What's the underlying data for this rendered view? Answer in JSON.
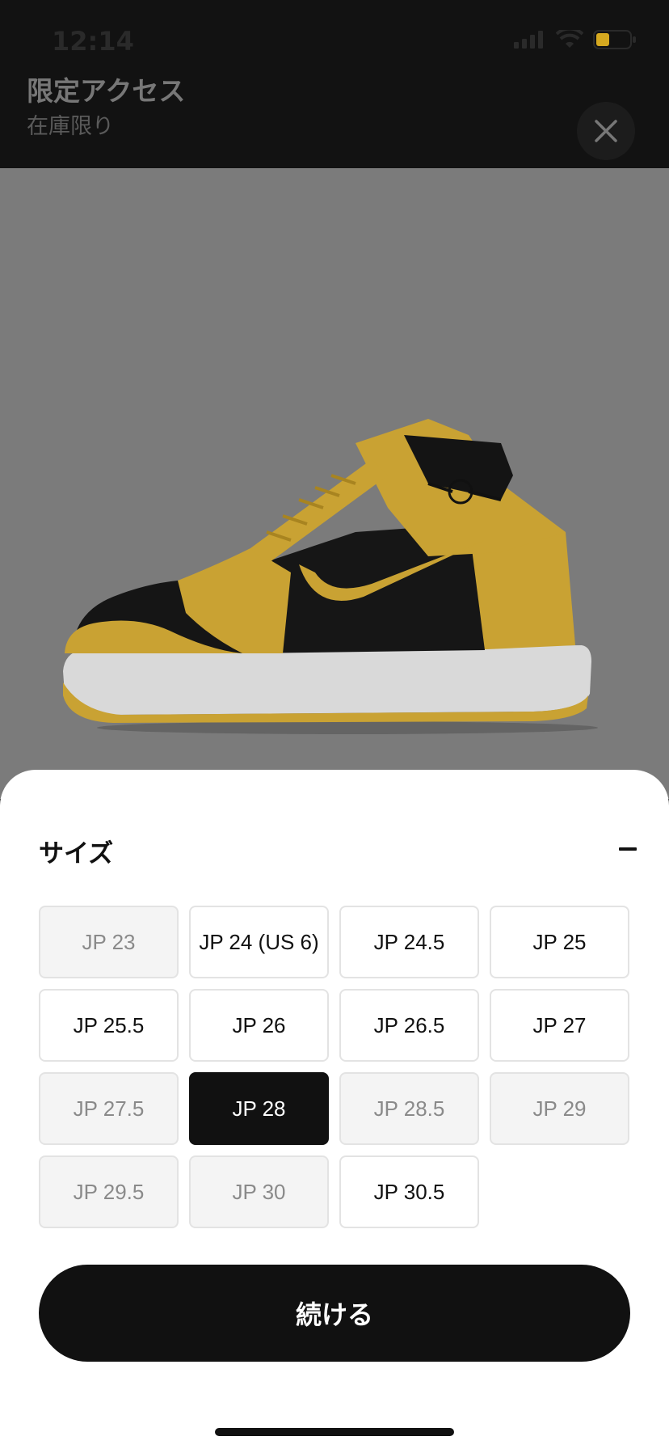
{
  "status_bar": {
    "time": "12:14"
  },
  "header": {
    "title": "限定アクセス",
    "subtitle": "在庫限り"
  },
  "product": {
    "image_icon": "sneaker-image",
    "colors": {
      "upper_yellow": "#c9a233",
      "upper_black": "#111111",
      "sole": "#e2e2e2"
    }
  },
  "sheet": {
    "title": "サイズ",
    "sizes": [
      {
        "label": "JP 23",
        "state": "disabled"
      },
      {
        "label": "JP 24 (US 6)",
        "state": "available"
      },
      {
        "label": "JP 24.5",
        "state": "available"
      },
      {
        "label": "JP 25",
        "state": "available"
      },
      {
        "label": "JP 25.5",
        "state": "available"
      },
      {
        "label": "JP 26",
        "state": "available"
      },
      {
        "label": "JP 26.5",
        "state": "available"
      },
      {
        "label": "JP 27",
        "state": "available"
      },
      {
        "label": "JP 27.5",
        "state": "disabled"
      },
      {
        "label": "JP 28",
        "state": "selected"
      },
      {
        "label": "JP 28.5",
        "state": "disabled"
      },
      {
        "label": "JP 29",
        "state": "disabled"
      },
      {
        "label": "JP 29.5",
        "state": "disabled"
      },
      {
        "label": "JP 30",
        "state": "disabled"
      },
      {
        "label": "JP 30.5",
        "state": "available"
      }
    ],
    "continue_label": "続ける"
  }
}
